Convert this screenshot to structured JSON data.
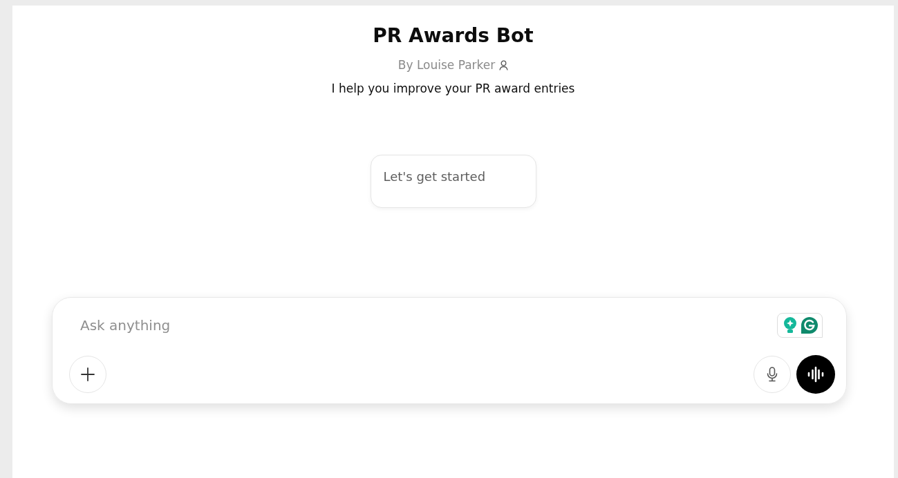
{
  "header": {
    "title": "PR Awards Bot",
    "byline": "By Louise Parker",
    "description": "I help you improve your PR award entries"
  },
  "starters": [
    "Let's get started"
  ],
  "composer": {
    "placeholder": "Ask anything"
  }
}
